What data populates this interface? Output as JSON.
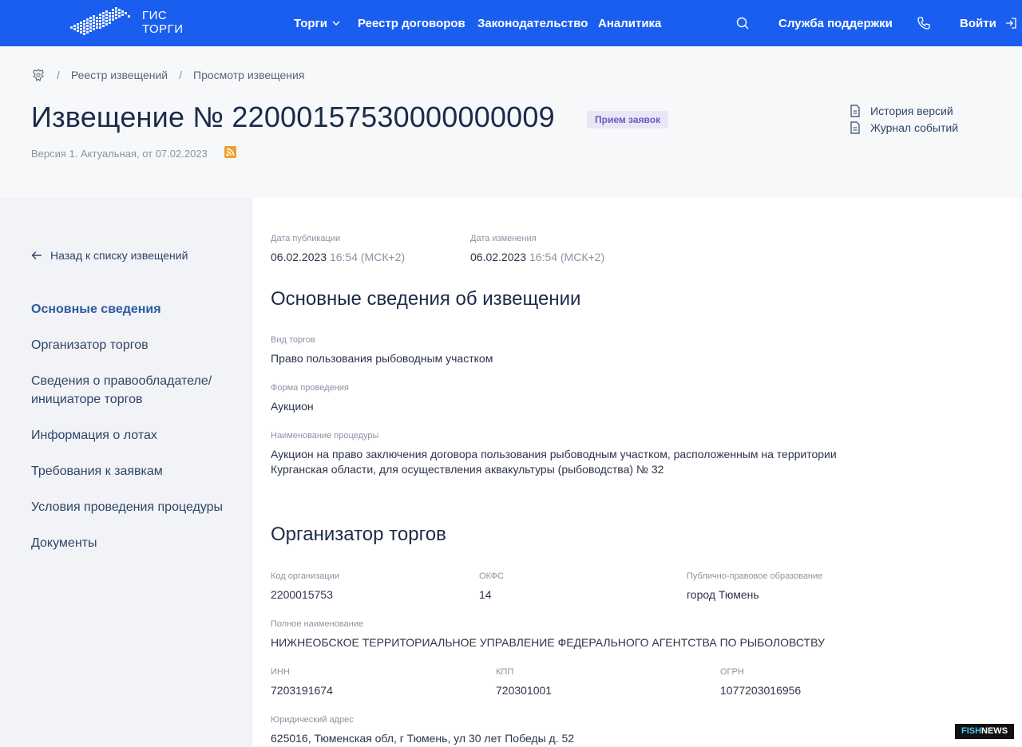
{
  "header": {
    "logo_line1": "ГИС",
    "logo_line2": "ТОРГИ",
    "nav": {
      "torgi": "Торги",
      "reestr": "Реестр договоров",
      "zakon": "Законодательство",
      "analit": "Аналитика"
    },
    "support": "Служба поддержки",
    "login": "Войти"
  },
  "breadcrumb": {
    "item1": "Реестр извещений",
    "item2": "Просмотр извещения",
    "separator": "/"
  },
  "notice": {
    "title": "Извещение № 22000157530000000009",
    "status": "Прием заявок",
    "version": "Версия 1. Актуальная, от 07.02.2023",
    "links": {
      "history": "История версий",
      "journal": "Журнал событий"
    }
  },
  "sidebar": {
    "back": "Назад к списку извещений",
    "items": [
      "Основные сведения",
      "Организатор торгов",
      "Сведения о правообладателе/ инициаторе торгов",
      "Информация о лотах",
      "Требования к заявкам",
      "Условия проведения процедуры",
      "Документы"
    ]
  },
  "dates": {
    "pub_label": "Дата публикации",
    "pub_date": "06.02.2023",
    "pub_time": "16:54 (МСК+2)",
    "mod_label": "Дата изменения",
    "mod_date": "06.02.2023",
    "mod_time": "16:54 (МСК+2)"
  },
  "basic": {
    "title": "Основные сведения об извещении",
    "type_label": "Вид торгов",
    "type_value": "Право пользования рыбоводным участком",
    "form_label": "Форма проведения",
    "form_value": "Аукцион",
    "name_label": "Наименование процедуры",
    "name_value_line1": "Аукцион на право заключения договора пользования рыбоводным участком, расположенным на территории",
    "name_value_line2": "Курганская области, для осуществления аквакультуры (рыбоводства) № 32"
  },
  "organizer": {
    "title": "Организатор торгов",
    "code_label": "Код организации",
    "code_value": "2200015753",
    "okfs_label": "ОКФС",
    "okfs_value": "14",
    "ppo_label": "Публично-правовое образование",
    "ppo_value": "город Тюмень",
    "full_label": "Полное наименование",
    "full_value": "НИЖНЕОБСКОЕ ТЕРРИТОРИАЛЬНОЕ УПРАВЛЕНИЕ ФЕДЕРАЛЬНОГО АГЕНТСТВА ПО РЫБОЛОВСТВУ",
    "inn_label": "ИНН",
    "inn_value": "7203191674",
    "kpp_label": "КПП",
    "kpp_value": "720301001",
    "ogrn_label": "ОГРН",
    "ogrn_value": "1077203016956",
    "addr_label": "Юридический адрес",
    "addr_value": "625016, Тюменская обл, г Тюмень, ул 30 лет Победы д. 52"
  },
  "watermark": {
    "fish": "FISH",
    "news": "NEWS"
  },
  "colors": {
    "header_bg": "#1a5ef0",
    "status_bg": "#e9e6f6",
    "status_text": "#7156c0",
    "active_nav": "#2c5aa0"
  }
}
